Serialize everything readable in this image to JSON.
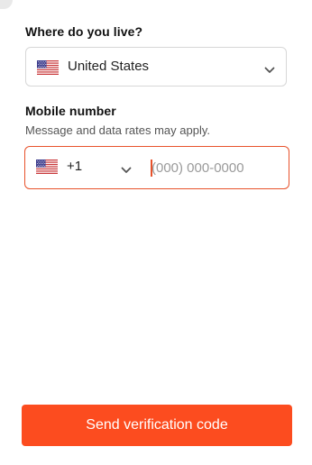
{
  "country_section": {
    "label": "Where do you live?",
    "selected_country": "United States",
    "flag_icon": "us-flag-icon"
  },
  "mobile_section": {
    "label": "Mobile number",
    "helper": "Message and data rates may apply.",
    "dial_code": "+1",
    "flag_icon": "us-flag-icon",
    "phone_placeholder": "(000) 000-0000",
    "phone_value": ""
  },
  "actions": {
    "send_label": "Send verification code"
  },
  "colors": {
    "accent": "#fc4c1f",
    "focus_border": "#e8522b",
    "border": "#d7d7d7"
  }
}
